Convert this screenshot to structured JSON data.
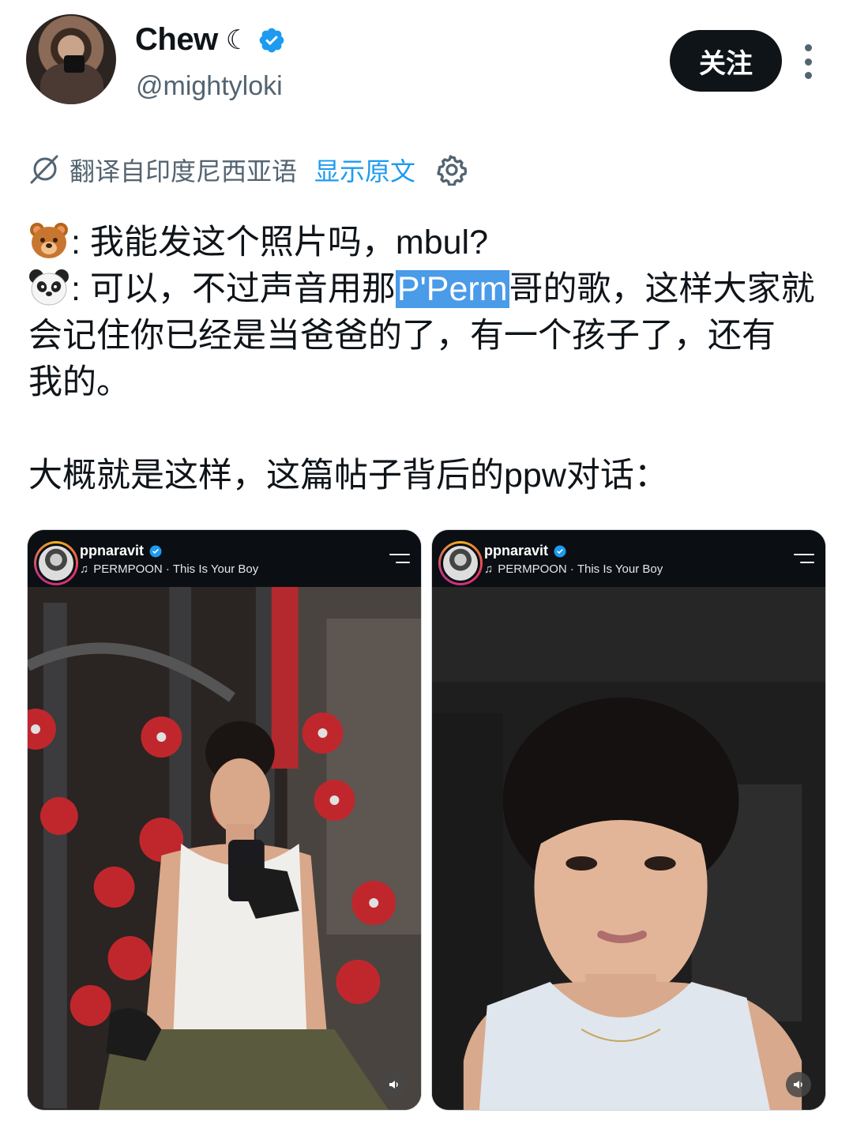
{
  "author": {
    "name": "Chew",
    "name_suffix": "☾",
    "handle": "@mightyloki",
    "verified": true
  },
  "follow_label": "关注",
  "translation": {
    "note": "翻译自印度尼西亚语",
    "show_original": "显示原文"
  },
  "tweet": {
    "line1_text": ": 我能发这个照片吗，mbul?",
    "line2_before": ": 可以，不过声音用那",
    "line2_selected": "P'Perm",
    "line2_after": "哥的歌，这样大家就",
    "line3": "会记住你已经是当爸爸的了，有一个孩子了，还有",
    "line4": "我的。",
    "line5": "大概就是这样，这篇帖子背后的ppw对话："
  },
  "media": [
    {
      "username": "ppnaravit",
      "song": "PERMPOON · This Is Your Boy"
    },
    {
      "username": "ppnaravit",
      "song": "PERMPOON · This Is Your Boy"
    }
  ],
  "colors": {
    "text": "#0f1419",
    "secondary": "#536471",
    "link": "#1d9bf0",
    "verified": "#1d9bf0",
    "follow_bg": "#0f1419",
    "selection": "#4a9be8"
  },
  "icons": [
    "verified-badge-icon",
    "more-options-icon",
    "translate-icon",
    "gear-icon",
    "bear-emoji-icon",
    "panda-emoji-icon",
    "music-note-icon",
    "menu-icon",
    "sound-icon"
  ]
}
